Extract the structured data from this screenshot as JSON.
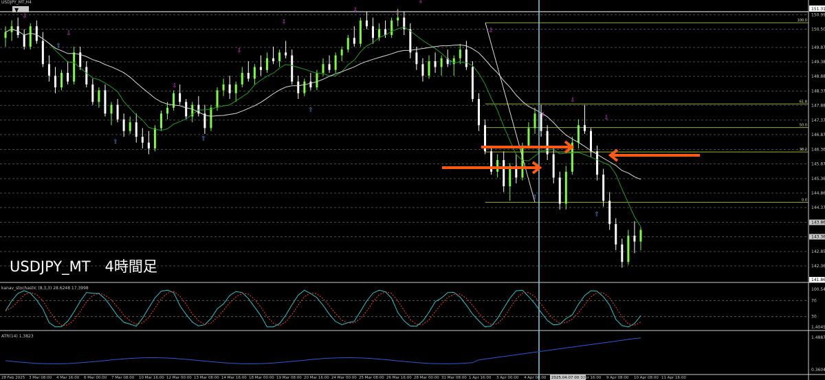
{
  "window": {
    "symbol_label": "USDJPY_MT,H4",
    "overlay_title": "USDJPY_MT　4時間足"
  },
  "colors": {
    "background": "#000000",
    "bull_candle": "#7cfc3c",
    "bear_candle": "#ffffff",
    "ma_fast": "#1f9e1f",
    "ma_slow": "#d8d8d8",
    "fib": "#8fb43a",
    "crosshair": "#7fd4e8",
    "arrow": "#ff5a14",
    "stoch_main": "#28c8c8",
    "stoch_signal": "#ff3c3c",
    "atr": "#2a5ad8",
    "up_signal": "#4aa8ff",
    "down_signal": "#e040e0"
  },
  "price_axis": {
    "top_box": "151.315",
    "bottom_box": "141.865",
    "labels": [
      "150.995",
      "150.500",
      "149.875",
      "149.380",
      "148.880",
      "148.375",
      "147.880",
      "147.375",
      "146.875",
      "146.365",
      "145.870",
      "145.365",
      "144.865",
      "144.370",
      "143.860",
      "143.365",
      "142.855",
      "142.360"
    ],
    "boxes": [
      "143.860",
      "143.365"
    ]
  },
  "fib_levels": [
    {
      "label": "100.0",
      "price": 150.72
    },
    {
      "label": "61.8",
      "price": 147.93
    },
    {
      "label": "50.0",
      "price": 147.12
    },
    {
      "label": "38.2",
      "price": 146.28
    },
    {
      "label": "0.0",
      "price": 144.55
    }
  ],
  "stochastic": {
    "label": "kanav_stochastic (8,3,3) 28.6248 17.3998",
    "axis": [
      "100.546",
      "70",
      "30",
      "1.4045"
    ]
  },
  "atr": {
    "label": "ATR(14) 1.3823",
    "axis": [
      "1.4887",
      "0.3604"
    ]
  },
  "time_axis": {
    "labels": [
      "28 Feb 2025",
      "3 Mar 08:00",
      "4 Mar 16:00",
      "6 Mar 00:00",
      "7 Mar 08:00",
      "10 Mar 16:00",
      "12 Mar 00:00",
      "13 Mar 08:00",
      "14 Mar 16:00",
      "18 Mar 00:00",
      "19 Mar 08:00",
      "20 Mar 16:00",
      "24 Mar 00:00",
      "25 Mar 08:00",
      "26 Mar 16:00",
      "28 Mar 00:00",
      "31 Mar 08:00",
      "1 Apr 16:00",
      "3 Apr 00:00",
      "4 Apr 08:00",
      "2025.04.07 00:00",
      "8 Apr 16:00",
      "9 Apr 08:00",
      "10 Apr 08:00",
      "11 Apr 16:00"
    ],
    "highlight": "2025.04.07 00:00"
  },
  "chart_data": {
    "type": "candlestick",
    "title": "USDJPY_MT　4時間足",
    "ylim": [
      141.865,
      151.315
    ],
    "candles": [
      [
        150.2,
        150.6,
        149.9,
        150.4
      ],
      [
        150.4,
        150.8,
        150.1,
        150.6
      ],
      [
        150.6,
        150.9,
        150.2,
        150.3
      ],
      [
        150.3,
        150.5,
        149.8,
        149.9
      ],
      [
        149.9,
        150.7,
        149.8,
        150.6
      ],
      [
        150.6,
        150.8,
        150.0,
        150.1
      ],
      [
        150.1,
        150.4,
        149.2,
        149.3
      ],
      [
        149.3,
        149.6,
        148.7,
        148.9
      ],
      [
        148.9,
        149.2,
        148.3,
        148.5
      ],
      [
        148.5,
        149.1,
        148.4,
        149.0
      ],
      [
        149.0,
        149.4,
        148.6,
        148.7
      ],
      [
        148.7,
        149.9,
        148.6,
        149.7
      ],
      [
        149.7,
        149.9,
        149.1,
        149.2
      ],
      [
        149.2,
        149.4,
        148.5,
        148.6
      ],
      [
        148.6,
        148.8,
        147.9,
        148.0
      ],
      [
        148.0,
        148.5,
        147.8,
        148.4
      ],
      [
        148.4,
        148.6,
        147.5,
        147.6
      ],
      [
        147.6,
        148.0,
        147.2,
        147.9
      ],
      [
        147.9,
        148.1,
        147.3,
        147.4
      ],
      [
        147.4,
        147.6,
        146.8,
        147.0
      ],
      [
        147.0,
        147.5,
        146.9,
        147.3
      ],
      [
        147.3,
        147.6,
        146.6,
        146.8
      ],
      [
        146.8,
        147.1,
        146.4,
        146.6
      ],
      [
        146.6,
        147.0,
        146.2,
        146.4
      ],
      [
        146.4,
        147.2,
        146.3,
        147.1
      ],
      [
        147.1,
        147.7,
        147.0,
        147.6
      ],
      [
        147.6,
        148.0,
        147.4,
        147.8
      ],
      [
        147.8,
        148.4,
        147.7,
        148.3
      ],
      [
        148.3,
        148.6,
        147.9,
        148.0
      ],
      [
        148.0,
        148.1,
        147.4,
        147.5
      ],
      [
        147.5,
        148.0,
        147.3,
        147.9
      ],
      [
        147.9,
        148.2,
        147.5,
        147.6
      ],
      [
        147.6,
        147.9,
        146.9,
        147.1
      ],
      [
        147.1,
        147.9,
        147.0,
        147.8
      ],
      [
        147.8,
        148.5,
        147.7,
        148.4
      ],
      [
        148.4,
        148.8,
        148.2,
        148.6
      ],
      [
        148.6,
        148.9,
        148.1,
        148.3
      ],
      [
        148.3,
        148.7,
        148.0,
        148.6
      ],
      [
        148.6,
        149.2,
        148.5,
        149.0
      ],
      [
        149.0,
        149.4,
        148.7,
        148.8
      ],
      [
        148.8,
        149.3,
        148.6,
        149.2
      ],
      [
        149.2,
        149.6,
        148.9,
        149.1
      ],
      [
        149.1,
        149.7,
        149.0,
        149.5
      ],
      [
        149.5,
        149.9,
        149.3,
        149.4
      ],
      [
        149.4,
        149.8,
        149.2,
        149.7
      ],
      [
        149.7,
        150.1,
        149.5,
        149.6
      ],
      [
        149.6,
        149.8,
        148.6,
        148.7
      ],
      [
        148.7,
        148.9,
        148.1,
        148.3
      ],
      [
        148.3,
        148.8,
        148.2,
        148.7
      ],
      [
        148.7,
        149.0,
        148.4,
        148.5
      ],
      [
        148.5,
        149.1,
        148.4,
        149.0
      ],
      [
        149.0,
        149.5,
        148.9,
        149.3
      ],
      [
        149.3,
        149.6,
        149.0,
        149.1
      ],
      [
        149.1,
        149.7,
        149.0,
        149.6
      ],
      [
        149.6,
        149.9,
        149.4,
        149.8
      ],
      [
        149.8,
        150.3,
        149.7,
        150.2
      ],
      [
        150.2,
        150.6,
        149.9,
        150.0
      ],
      [
        150.0,
        150.9,
        149.9,
        150.8
      ],
      [
        150.8,
        151.1,
        150.5,
        150.6
      ],
      [
        150.6,
        150.9,
        150.0,
        150.2
      ],
      [
        150.2,
        150.7,
        150.1,
        150.5
      ],
      [
        150.5,
        150.8,
        150.2,
        150.3
      ],
      [
        150.3,
        150.9,
        150.2,
        150.8
      ],
      [
        150.8,
        151.2,
        150.6,
        150.9
      ],
      [
        150.9,
        151.1,
        150.3,
        150.5
      ],
      [
        150.5,
        150.7,
        149.5,
        149.7
      ],
      [
        149.7,
        149.9,
        149.1,
        149.3
      ],
      [
        149.3,
        149.5,
        148.7,
        148.9
      ],
      [
        148.9,
        149.6,
        148.8,
        149.4
      ],
      [
        149.4,
        149.7,
        149.0,
        149.2
      ],
      [
        149.2,
        149.6,
        148.9,
        149.5
      ],
      [
        149.5,
        149.8,
        149.2,
        149.3
      ],
      [
        149.3,
        149.6,
        148.9,
        149.5
      ],
      [
        149.5,
        150.0,
        149.3,
        149.8
      ],
      [
        149.8,
        150.1,
        149.1,
        149.2
      ],
      [
        149.2,
        149.4,
        148.0,
        148.1
      ],
      [
        148.1,
        148.3,
        147.0,
        147.2
      ],
      [
        147.2,
        147.4,
        146.2,
        146.3
      ],
      [
        146.3,
        146.5,
        145.5,
        145.6
      ],
      [
        145.6,
        146.2,
        145.4,
        146.0
      ],
      [
        146.0,
        146.3,
        144.9,
        145.1
      ],
      [
        145.1,
        145.9,
        144.6,
        145.8
      ],
      [
        145.8,
        146.2,
        145.2,
        145.4
      ],
      [
        145.4,
        146.6,
        145.3,
        146.5
      ],
      [
        146.5,
        147.3,
        146.4,
        147.1
      ],
      [
        147.1,
        147.8,
        146.9,
        147.6
      ],
      [
        147.6,
        147.9,
        146.8,
        147.0
      ],
      [
        147.0,
        147.2,
        146.0,
        146.2
      ],
      [
        146.2,
        146.4,
        145.2,
        145.4
      ],
      [
        145.4,
        145.6,
        144.3,
        144.5
      ],
      [
        144.5,
        145.8,
        144.3,
        145.6
      ],
      [
        145.6,
        146.8,
        145.5,
        146.6
      ],
      [
        146.6,
        147.4,
        146.4,
        147.2
      ],
      [
        147.2,
        147.9,
        146.9,
        147.0
      ],
      [
        147.0,
        147.1,
        146.1,
        146.3
      ],
      [
        146.3,
        146.5,
        145.3,
        145.5
      ],
      [
        145.5,
        145.7,
        144.4,
        144.6
      ],
      [
        144.6,
        144.9,
        143.6,
        143.8
      ],
      [
        143.8,
        144.0,
        142.9,
        143.1
      ],
      [
        143.1,
        143.3,
        142.3,
        142.5
      ],
      [
        142.5,
        143.6,
        142.4,
        143.4
      ],
      [
        143.4,
        143.9,
        142.8,
        143.2
      ],
      [
        143.2,
        143.7,
        142.9,
        143.6
      ]
    ]
  }
}
